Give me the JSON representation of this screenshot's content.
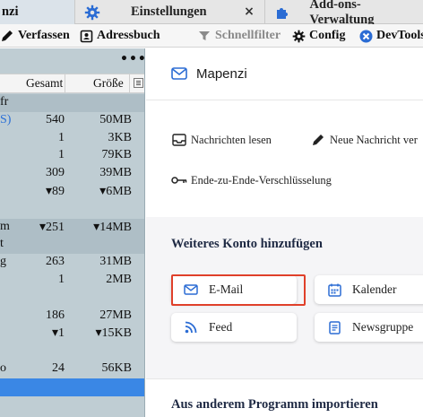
{
  "tabs": [
    {
      "label": "nzi",
      "active": true
    },
    {
      "label": "Einstellungen",
      "icon": "gear-icon",
      "closable": true
    },
    {
      "label": "Add-ons-Verwaltung",
      "icon": "puzzle-icon"
    }
  ],
  "tab_close_glyph": "×",
  "toolbar": {
    "compose": "Verfassen",
    "addressbook": "Adressbuch",
    "quickfilter": "Schnellfilter",
    "config": "Config",
    "devtools": "DevTools"
  },
  "folder_pane": {
    "more_glyph": "•••",
    "columns": {
      "total": "Gesamt",
      "size": "Größe"
    },
    "rows": [
      {
        "name": "fr",
        "total": "",
        "size": "",
        "group": true
      },
      {
        "name": "S)",
        "total": "540",
        "size": "50MB",
        "link": true
      },
      {
        "name": "",
        "total": "1",
        "size": "3KB"
      },
      {
        "name": "",
        "total": "1",
        "size": "79KB"
      },
      {
        "name": "",
        "total": "309",
        "size": "39MB"
      },
      {
        "name": "",
        "total": "▾89",
        "size": "▾6MB"
      },
      {
        "name": "",
        "total": "",
        "size": ""
      },
      {
        "name": "m",
        "total": "▾251",
        "size": "▾14MB",
        "group": true
      },
      {
        "name": "t",
        "total": "",
        "size": "",
        "group": true
      },
      {
        "name": "g",
        "total": "263",
        "size": "31MB"
      },
      {
        "name": "",
        "total": "1",
        "size": "2MB"
      },
      {
        "name": "",
        "total": "",
        "size": ""
      },
      {
        "name": "",
        "total": "186",
        "size": "27MB"
      },
      {
        "name": "",
        "total": "▾1",
        "size": "▾15KB"
      },
      {
        "name": "",
        "total": "",
        "size": ""
      },
      {
        "name": "o",
        "total": "24",
        "size": "56KB"
      },
      {
        "name": "",
        "total": "",
        "size": "",
        "selected": true
      }
    ]
  },
  "account": {
    "title": "Mapenzi",
    "actions": {
      "read": "Nachrichten lesen",
      "new": "Neue Nachricht ver",
      "e2e": "Ende-zu-Ende-Verschlüsselung"
    },
    "add_section_title": "Weiteres Konto hinzufügen",
    "add_cards": {
      "email": "E-Mail",
      "calendar": "Kalender",
      "feed": "Feed",
      "newsgroup": "Newsgruppe"
    },
    "import_title": "Aus anderem Programm importieren"
  },
  "colors": {
    "accent": "#2b6cd4",
    "highlight_box": "#e0402a",
    "folder_pane_bg": "#bfcdd3",
    "selection": "#3a87e5"
  }
}
